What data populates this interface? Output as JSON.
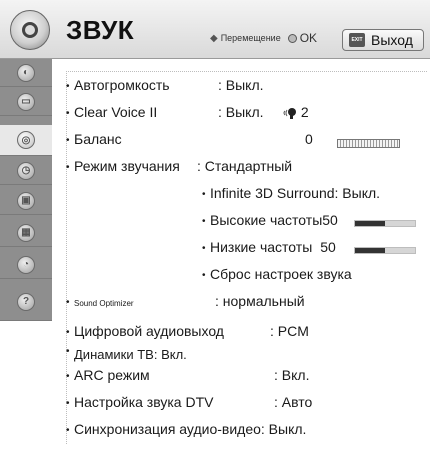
{
  "header": {
    "title": "ЗВУК",
    "nav_hint": "Перемещение",
    "ok_label": "OK",
    "exit_label": "Выход",
    "exit_key_label": "EXIT"
  },
  "sidebar": {
    "items": [
      {
        "icon": "picture-icon"
      },
      {
        "icon": "monitor-icon"
      },
      {
        "icon": "speaker-icon",
        "active": true
      },
      {
        "icon": "clock-icon"
      },
      {
        "icon": "lock-icon"
      },
      {
        "icon": "calendar-icon"
      },
      {
        "icon": "network-icon"
      },
      {
        "icon": "help-icon"
      }
    ]
  },
  "settings": {
    "auto_volume": {
      "label": "Автогромкость",
      "value": ": Выкл."
    },
    "clear_voice": {
      "label": "Clear Voice II",
      "value": ": Выкл.",
      "level": "2"
    },
    "balance": {
      "label": "Баланс",
      "value": "0"
    },
    "sound_mode": {
      "label": "Режим звучания",
      "value": ": Стандартный"
    },
    "surround": {
      "label": "Infinite 3D Surround: Выкл."
    },
    "treble": {
      "label": "Высокие частоты",
      "value": "50",
      "level": 0.5
    },
    "bass": {
      "label": "Низкие частоты",
      "value": "50",
      "level": 0.5
    },
    "reset": {
      "label": "Сброс настроек звука"
    },
    "sound_optimizer": {
      "label": "Sound Optimizer",
      "value": ": нормальный"
    },
    "digital_out": {
      "label": "Цифровой аудиовыход",
      "value": ": PCM"
    },
    "tv_speakers": {
      "label": "Динамики ТВ: Вкл."
    },
    "arc": {
      "label": "ARC режим",
      "value": ": Вкл."
    },
    "dtv_sound": {
      "label": "Настройка звука DTV",
      "value": ": Авто"
    },
    "av_sync": {
      "label": "Синхронизация аудио-видео: Выкл."
    }
  },
  "colors": {
    "sidebar": "#8e8e8e",
    "active_item": "#e8e8e8",
    "bar_fill": "#333333"
  }
}
